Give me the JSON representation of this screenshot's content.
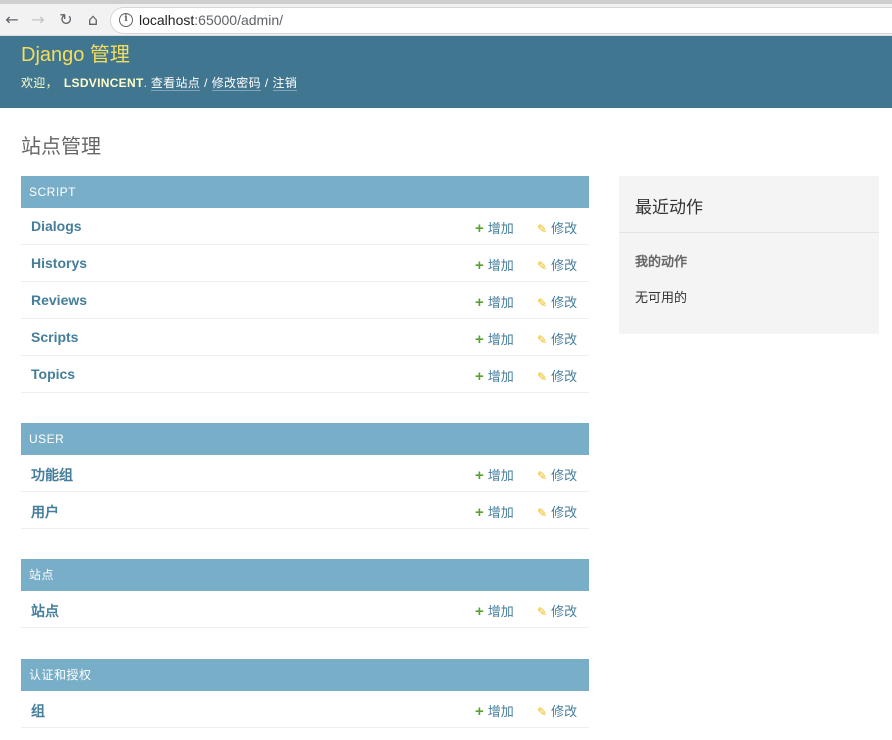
{
  "browser": {
    "url_host": "localhost",
    "url_rest": ":65000/admin/"
  },
  "header": {
    "branding": "Django 管理",
    "welcome": "欢迎，",
    "username": "LSDVINCENT",
    "view_site": "查看站点",
    "change_password": "修改密码",
    "logout": "注销",
    "separator": "/"
  },
  "page_title": "站点管理",
  "modules": [
    {
      "caption": "SCRIPT",
      "models": [
        {
          "name": "Dialogs",
          "add": "增加",
          "change": "修改"
        },
        {
          "name": "Historys",
          "add": "增加",
          "change": "修改"
        },
        {
          "name": "Reviews",
          "add": "增加",
          "change": "修改"
        },
        {
          "name": "Scripts",
          "add": "增加",
          "change": "修改"
        },
        {
          "name": "Topics",
          "add": "增加",
          "change": "修改"
        }
      ]
    },
    {
      "caption": "USER",
      "models": [
        {
          "name": "功能组",
          "add": "增加",
          "change": "修改"
        },
        {
          "name": "用户",
          "add": "增加",
          "change": "修改"
        }
      ]
    },
    {
      "caption": "站点",
      "models": [
        {
          "name": "站点",
          "add": "增加",
          "change": "修改"
        }
      ]
    },
    {
      "caption": "认证和授权",
      "models": [
        {
          "name": "组",
          "add": "增加",
          "change": "修改"
        }
      ]
    }
  ],
  "recent_actions": {
    "title": "最近动作",
    "subtitle": "我的动作",
    "empty": "无可用的"
  },
  "icons": {
    "add": "plus-icon",
    "change": "pencil-icon"
  },
  "colors": {
    "header_bg": "#417690",
    "branding": "#f5dd5d",
    "module_caption_bg": "#79aec8",
    "link": "#447e9b",
    "add_icon": "#5ba033",
    "change_icon": "#efb80b"
  }
}
